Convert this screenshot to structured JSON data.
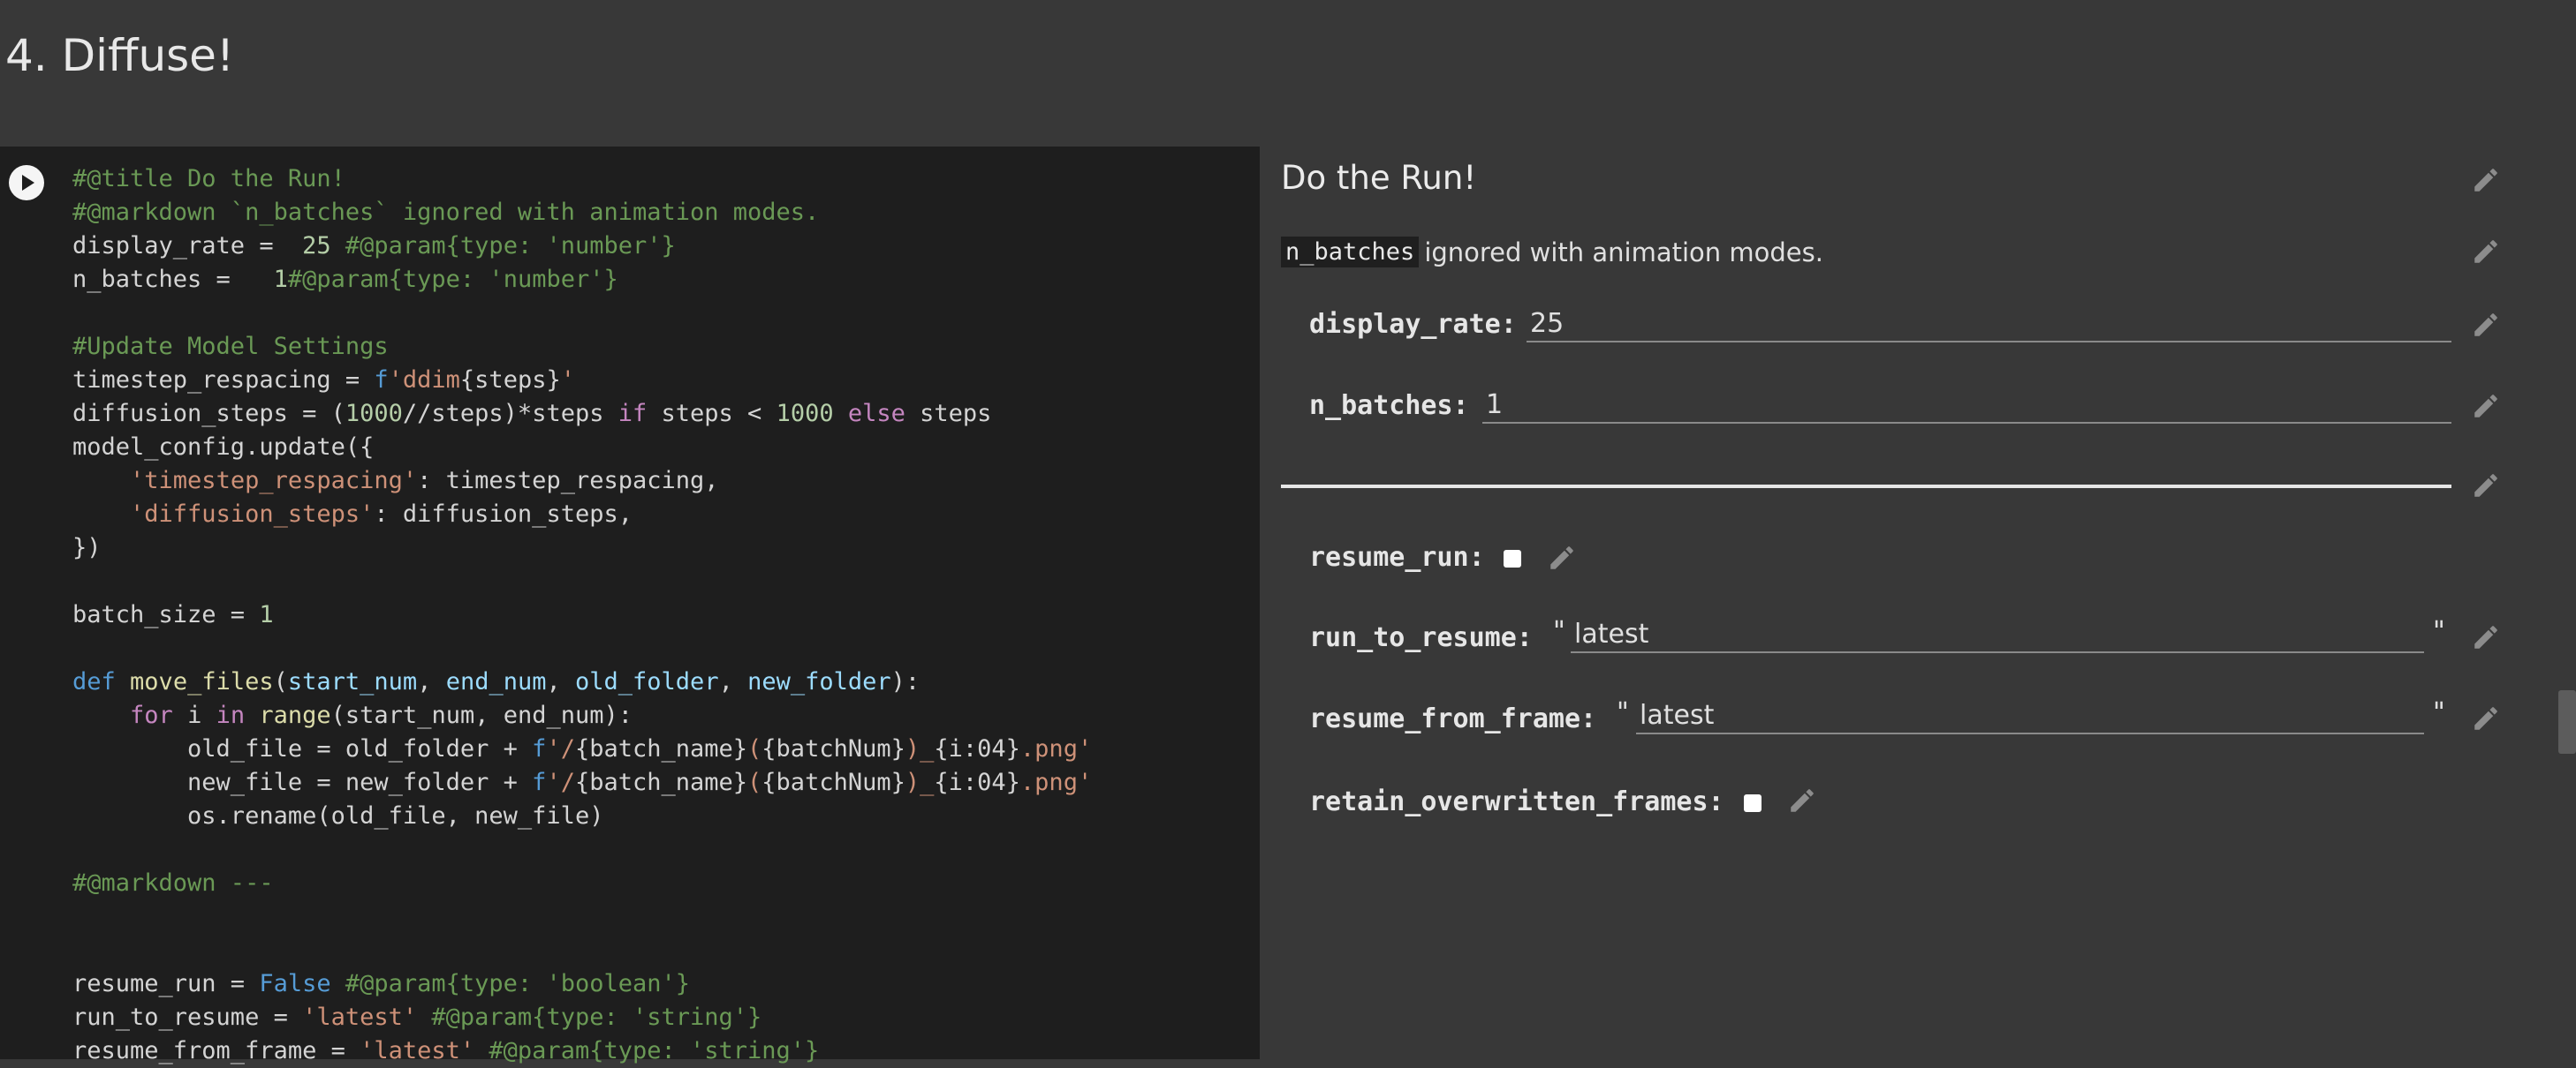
{
  "section": {
    "title": "4. Diffuse!"
  },
  "code": {
    "lines": [
      [
        {
          "t": "#@title Do the Run!",
          "c": "c"
        }
      ],
      [
        {
          "t": "#@markdown `n_batches` ignored with animation modes.",
          "c": "c"
        }
      ],
      [
        {
          "t": "display_rate = ",
          "c": "p"
        },
        {
          "t": " 25",
          "c": "n"
        },
        {
          "t": " #@param{type: 'number'}",
          "c": "c"
        }
      ],
      [
        {
          "t": "n_batches = ",
          "c": "p"
        },
        {
          "t": "  1",
          "c": "n"
        },
        {
          "t": "#@param{type: 'number'}",
          "c": "c"
        }
      ],
      [],
      [
        {
          "t": "#Update Model Settings",
          "c": "c"
        }
      ],
      [
        {
          "t": "timestep_respacing = ",
          "c": "p"
        },
        {
          "t": "f",
          "c": "b"
        },
        {
          "t": "'ddim",
          "c": "s"
        },
        {
          "t": "{steps}",
          "c": "p"
        },
        {
          "t": "'",
          "c": "s"
        }
      ],
      [
        {
          "t": "diffusion_steps = (",
          "c": "p"
        },
        {
          "t": "1000",
          "c": "n"
        },
        {
          "t": "//steps)*steps ",
          "c": "p"
        },
        {
          "t": "if",
          "c": "k"
        },
        {
          "t": " steps < ",
          "c": "p"
        },
        {
          "t": "1000",
          "c": "n"
        },
        {
          "t": " ",
          "c": "p"
        },
        {
          "t": "else",
          "c": "k"
        },
        {
          "t": " steps",
          "c": "p"
        }
      ],
      [
        {
          "t": "model_config.update({",
          "c": "p"
        }
      ],
      [
        {
          "t": "    ",
          "c": "p"
        },
        {
          "t": "'timestep_respacing'",
          "c": "s"
        },
        {
          "t": ": timestep_respacing,",
          "c": "p"
        }
      ],
      [
        {
          "t": "    ",
          "c": "p"
        },
        {
          "t": "'diffusion_steps'",
          "c": "s"
        },
        {
          "t": ": diffusion_steps,",
          "c": "p"
        }
      ],
      [
        {
          "t": "})",
          "c": "p"
        }
      ],
      [],
      [
        {
          "t": "batch_size = ",
          "c": "p"
        },
        {
          "t": "1",
          "c": "n"
        }
      ],
      [],
      [
        {
          "t": "def",
          "c": "d"
        },
        {
          "t": " ",
          "c": "p"
        },
        {
          "t": "move_files",
          "c": "f"
        },
        {
          "t": "(",
          "c": "p"
        },
        {
          "t": "start_num",
          "c": "v"
        },
        {
          "t": ", ",
          "c": "p"
        },
        {
          "t": "end_num",
          "c": "v"
        },
        {
          "t": ", ",
          "c": "p"
        },
        {
          "t": "old_folder",
          "c": "v"
        },
        {
          "t": ", ",
          "c": "p"
        },
        {
          "t": "new_folder",
          "c": "v"
        },
        {
          "t": "):",
          "c": "p"
        }
      ],
      [
        {
          "t": "    ",
          "c": "p"
        },
        {
          "t": "for",
          "c": "k"
        },
        {
          "t": " i ",
          "c": "p"
        },
        {
          "t": "in",
          "c": "k"
        },
        {
          "t": " ",
          "c": "p"
        },
        {
          "t": "range",
          "c": "f"
        },
        {
          "t": "(start_num, end_num):",
          "c": "p"
        }
      ],
      [
        {
          "t": "        old_file = old_folder + ",
          "c": "p"
        },
        {
          "t": "f",
          "c": "b"
        },
        {
          "t": "'/",
          "c": "s"
        },
        {
          "t": "{batch_name}",
          "c": "p"
        },
        {
          "t": "(",
          "c": "s"
        },
        {
          "t": "{batchNum}",
          "c": "p"
        },
        {
          "t": ")_",
          "c": "s"
        },
        {
          "t": "{i:04}",
          "c": "p"
        },
        {
          "t": ".png'",
          "c": "s"
        }
      ],
      [
        {
          "t": "        new_file = new_folder + ",
          "c": "p"
        },
        {
          "t": "f",
          "c": "b"
        },
        {
          "t": "'/",
          "c": "s"
        },
        {
          "t": "{batch_name}",
          "c": "p"
        },
        {
          "t": "(",
          "c": "s"
        },
        {
          "t": "{batchNum}",
          "c": "p"
        },
        {
          "t": ")_",
          "c": "s"
        },
        {
          "t": "{i:04}",
          "c": "p"
        },
        {
          "t": ".png'",
          "c": "s"
        }
      ],
      [
        {
          "t": "        os.rename(old_file, new_file)",
          "c": "p"
        }
      ],
      [],
      [
        {
          "t": "#@markdown ---",
          "c": "c"
        }
      ],
      [],
      [],
      [
        {
          "t": "resume_run = ",
          "c": "p"
        },
        {
          "t": "False",
          "c": "b"
        },
        {
          "t": " #@param{type: 'boolean'}",
          "c": "c"
        }
      ],
      [
        {
          "t": "run_to_resume = ",
          "c": "p"
        },
        {
          "t": "'latest'",
          "c": "s"
        },
        {
          "t": " #@param{type: 'string'}",
          "c": "c"
        }
      ],
      [
        {
          "t": "resume_from_frame = ",
          "c": "p"
        },
        {
          "t": "'latest'",
          "c": "s"
        },
        {
          "t": " #@param{type: 'string'}",
          "c": "c"
        }
      ]
    ],
    "colors": {
      "c": "#6a9955",
      "s": "#ce9178",
      "n": "#b5cea8",
      "k": "#c586c0",
      "d": "#569cd6",
      "f": "#dcdcaa",
      "v": "#9cdcfe",
      "b": "#569cd6",
      "p": "#d4d4d4"
    }
  },
  "form": {
    "title": "Do the Run!",
    "markdown_code": "n_batches",
    "markdown_text": "ignored with animation modes.",
    "fields": {
      "display_rate": {
        "label": "display_rate:",
        "value": "25"
      },
      "n_batches": {
        "label": "n_batches:",
        "value": "1"
      },
      "resume_run": {
        "label": "resume_run:",
        "checked": false
      },
      "run_to_resume": {
        "label": "run_to_resume:",
        "value": "latest",
        "quote": "\""
      },
      "resume_from_frame": {
        "label": "resume_from_frame:",
        "value": "latest",
        "quote": "\""
      },
      "retain_overwritten_frames": {
        "label": "retain_overwritten_frames:",
        "checked": false
      }
    }
  },
  "icons": {
    "run": "play-circle-icon",
    "edit": "pencil-icon"
  }
}
